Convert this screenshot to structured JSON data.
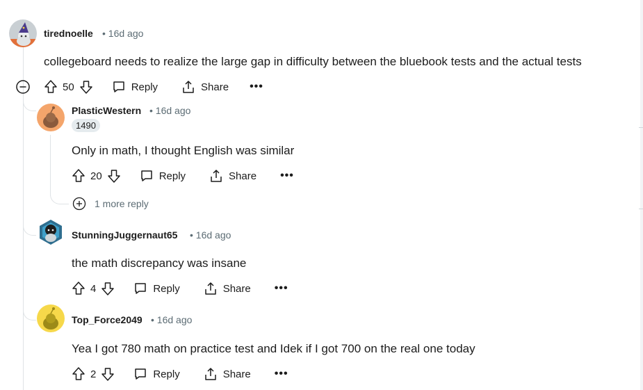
{
  "comments": [
    {
      "username": "tirednoelle",
      "time": "16d ago",
      "text": "collegeboard needs to realize the large gap in difficulty between the bluebook tests and the actual tests",
      "votes": "50",
      "reply_label": "Reply",
      "share_label": "Share",
      "avatar_color": "#c9cfd3"
    },
    {
      "username": "PlasticWestern",
      "time": "16d ago",
      "flair": "1490",
      "text": "Only in math, I thought English was similar",
      "votes": "20",
      "reply_label": "Reply",
      "share_label": "Share",
      "more_replies": "1 more reply",
      "avatar_color": "#f4a56b"
    },
    {
      "username": "StunningJuggernaut65",
      "time": "16d ago",
      "text": "the math discrepancy was insane",
      "votes": "4",
      "reply_label": "Reply",
      "share_label": "Share",
      "avatar_color": "#2f6e8f"
    },
    {
      "username": "Top_Force2049",
      "time": "16d ago",
      "text": "Yea I got 780 math on practice test and Idek if I got 700 on the real one today",
      "votes": "2",
      "reply_label": "Reply",
      "share_label": "Share",
      "avatar_color": "#f6d84a"
    }
  ],
  "separator": "•",
  "overflow": "•••"
}
